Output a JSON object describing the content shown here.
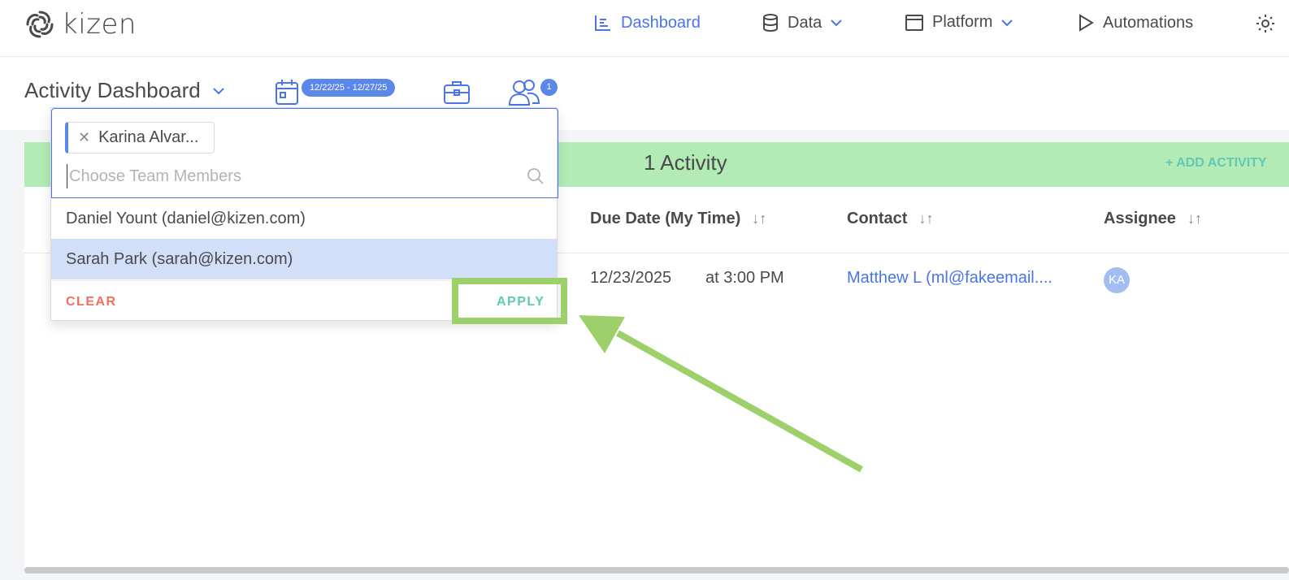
{
  "brand": {
    "name": "kizen"
  },
  "nav": {
    "items": [
      {
        "label": "Dashboard",
        "icon": "chart-icon",
        "active": true
      },
      {
        "label": "Data",
        "icon": "database-icon",
        "has_dropdown": true
      },
      {
        "label": "Platform",
        "icon": "window-icon",
        "has_dropdown": true
      },
      {
        "label": "Automations",
        "icon": "play-icon"
      }
    ],
    "settings_icon": "gear-icon"
  },
  "subheader": {
    "title": "Activity Dashboard",
    "date_range": "12/22/25 - 12/27/25",
    "team_count": "1"
  },
  "content": {
    "activity_count": "1 Activity",
    "add_activity": "+ ADD ACTIVITY",
    "columns": [
      "Due Date (My Time)",
      "Contact",
      "Assignee"
    ],
    "row": {
      "due_date": "12/23/2025",
      "due_time": "at 3:00 PM",
      "contact": "Matthew L (ml@fakeemail....",
      "assignee_initials": "KA"
    }
  },
  "dropdown": {
    "selected_chip": "Karina Alvar...",
    "search_placeholder": "Choose Team Members",
    "options": [
      {
        "label": "Daniel Yount (daniel@kizen.com)",
        "selected": false
      },
      {
        "label": "Sarah Park (sarah@kizen.com)",
        "selected": true
      }
    ],
    "clear_label": "CLEAR",
    "apply_label": "APPLY"
  },
  "colors": {
    "accent": "#4a74e8",
    "badge": "#5b86ea",
    "green_bar": "#b2ebb6",
    "apply": "#5fc9b2",
    "clear": "#f16f5e",
    "annotation": "#9dd06a"
  }
}
